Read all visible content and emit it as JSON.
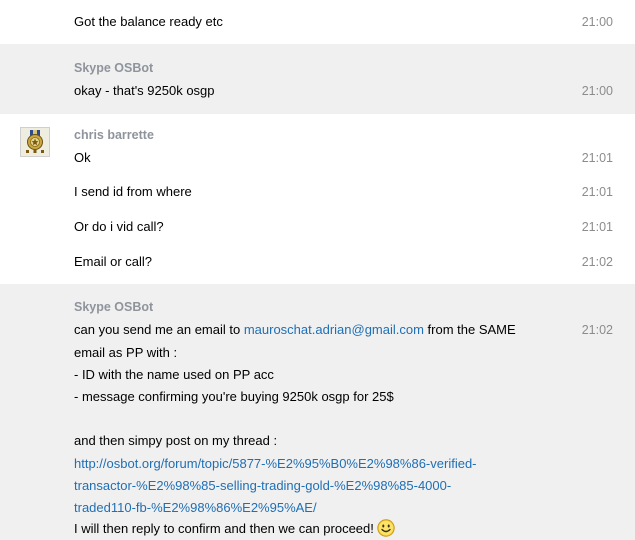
{
  "messages": {
    "m1": {
      "text": "Got the balance ready etc",
      "time": "21:00"
    },
    "group2": {
      "sender": "Skype OSBot",
      "m1": {
        "text": "okay - that's 9250k osgp",
        "time": "21:00"
      }
    },
    "group3": {
      "sender": "chris barrette",
      "avatar_icon": "medal-avatar-icon",
      "m1": {
        "text": "Ok",
        "time": "21:01"
      },
      "m2": {
        "text": "I send id from where",
        "time": "21:01"
      },
      "m3": {
        "text": "Or do i vid call?",
        "time": "21:01"
      },
      "m4": {
        "text": "Email or call?",
        "time": "21:02"
      }
    },
    "group4": {
      "sender": "Skype OSBot",
      "time": "21:02",
      "line1_pre": "can you send me an email to ",
      "line1_link": "mauroschat.adrian@gmail.com",
      "line1_post": " from the SAME",
      "line2": "email as PP with :",
      "line3": "- ID with the name used on PP acc",
      "line4": "- message confirming you're buying 9250k osgp for 25$",
      "line6": "and then simpy post on my thread :",
      "url1": "http://osbot.org/forum/topic/5877-%E2%95%B0%E2%98%86-verified-",
      "url2": "transactor-%E2%98%85-selling-trading-gold-%E2%98%85-4000-",
      "url3": "traded110-fb-%E2%98%86%E2%95%AE/",
      "line_last": "I will then reply to confirm and then we can proceed!",
      "emoji_icon": "smiley-emoji-icon"
    }
  },
  "colors": {
    "shaded_bg": "#f0f0f0",
    "link": "#1f6fb5",
    "sender": "#8f949c",
    "time": "#8c8c8c"
  }
}
